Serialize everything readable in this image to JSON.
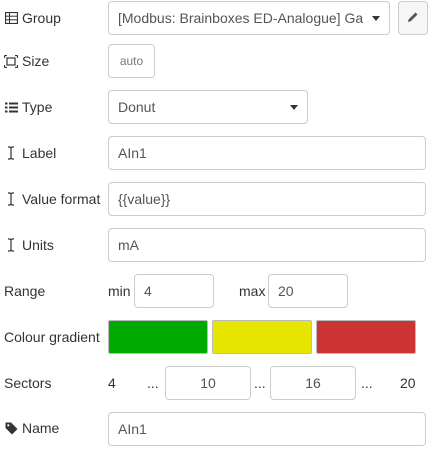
{
  "form": {
    "group": {
      "label": "Group",
      "icon": "table-icon",
      "value": "[Modbus: Brainboxes ED-Analogue] Ga",
      "edit_icon": "pencil-icon"
    },
    "size": {
      "label": "Size",
      "icon": "resize-icon",
      "value": "auto"
    },
    "type": {
      "label": "Type",
      "icon": "list-icon",
      "value": "Donut"
    },
    "label_field": {
      "label": "Label",
      "icon": "text-cursor-icon",
      "value": "AIn1"
    },
    "value_format": {
      "label": "Value format",
      "icon": "text-cursor-icon",
      "value": "{{value}}"
    },
    "units": {
      "label": "Units",
      "icon": "text-cursor-icon",
      "value": "mA"
    },
    "range": {
      "label": "Range",
      "min_label": "min",
      "min_value": "4",
      "max_label": "max",
      "max_value": "20"
    },
    "colour_gradient": {
      "label": "Colour gradient",
      "colors": [
        "#00aa00",
        "#e6e600",
        "#cc3333"
      ]
    },
    "sectors": {
      "label": "Sectors",
      "start": "4",
      "ellipsis": "...",
      "first": "10",
      "second": "16",
      "end": "20"
    },
    "name": {
      "label": "Name",
      "icon": "tag-icon",
      "value": "AIn1"
    }
  }
}
